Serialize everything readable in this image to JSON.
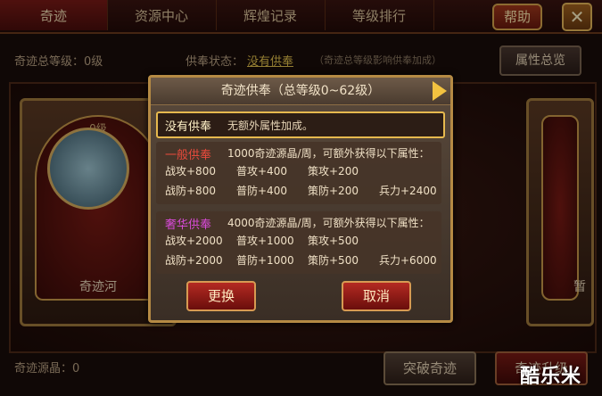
{
  "tabs": [
    {
      "label": "奇迹",
      "active": true
    },
    {
      "label": "资源中心",
      "active": false
    },
    {
      "label": "辉煌记录",
      "active": false
    },
    {
      "label": "等级排行",
      "active": false
    }
  ],
  "header": {
    "help_label": "帮助",
    "close_glyph": "✕"
  },
  "subbar": {
    "total_level": "奇迹总等级：0级",
    "offer_status_label": "供奉状态：",
    "offer_status_value": "没有供奉",
    "offer_hint": "（奇迹总等级影响供奉加成）",
    "attr_button": "属性总览"
  },
  "cards": [
    {
      "level": "0级",
      "name": "奇迹河"
    },
    {
      "level": "",
      "name": "暂"
    }
  ],
  "bottom": {
    "resource": "奇迹源晶：0",
    "break_button": "突破奇迹",
    "upgrade_button": "奇迹升级"
  },
  "watermark": "酷乐米",
  "modal": {
    "title": "奇迹供奉（总等级0~62级）",
    "none_option": {
      "label": "没有供奉",
      "desc": "无额外属性加成。"
    },
    "options": [
      {
        "name": "一般供奉",
        "name_color": "#e64a3c",
        "rate": "1000奇迹源晶/周，可额外获得以下属性：",
        "stats": [
          "战攻+800",
          "普攻+400",
          "策攻+200",
          "",
          "战防+800",
          "普防+400",
          "策防+200",
          "兵力+2400"
        ]
      },
      {
        "name": "奢华供奉",
        "name_color": "#d64ad6",
        "rate": "4000奇迹源晶/周，可额外获得以下属性：",
        "stats": [
          "战攻+2000",
          "普攻+1000",
          "策攻+500",
          "",
          "战防+2000",
          "普防+1000",
          "策防+500",
          "兵力+6000"
        ]
      }
    ],
    "confirm_label": "更换",
    "cancel_label": "取消"
  }
}
